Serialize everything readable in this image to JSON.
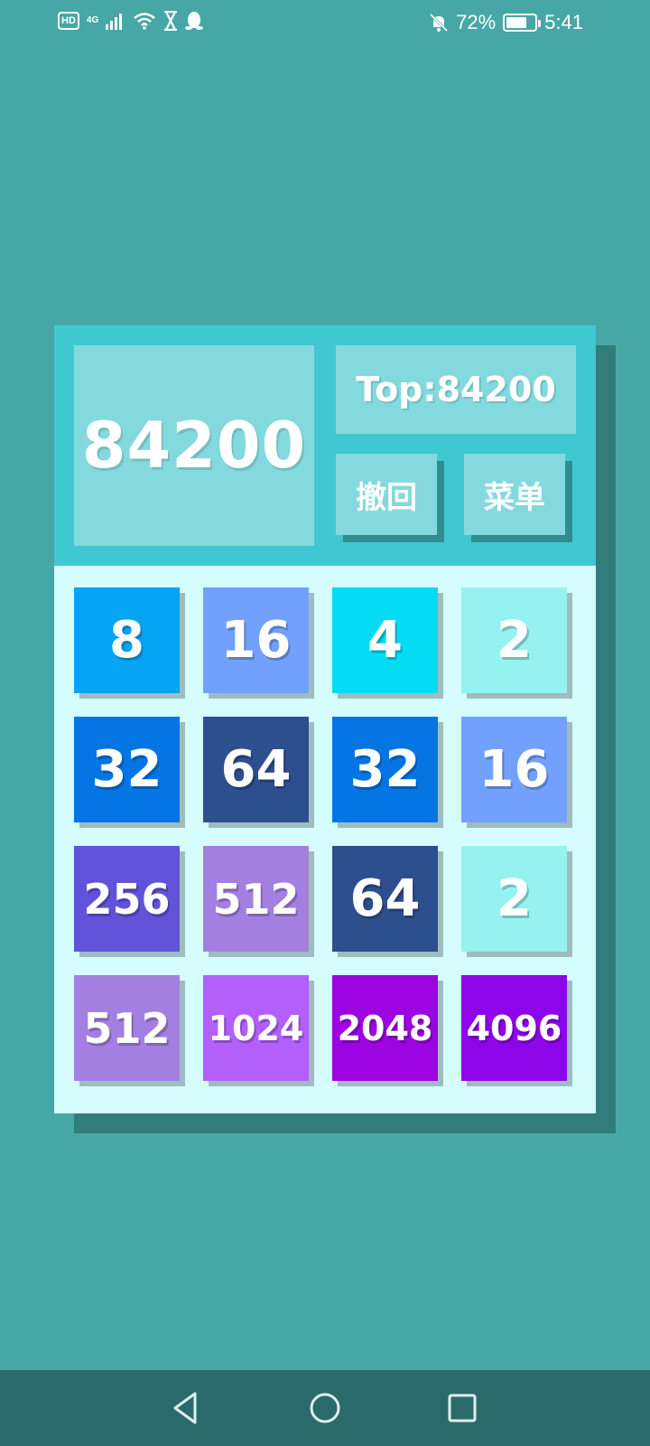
{
  "status_bar": {
    "hd": "HD",
    "network": "4G",
    "battery_percent": "72%",
    "battery_level": 0.72,
    "time": "5:41",
    "icons": [
      "signal-icon",
      "wifi-icon",
      "hourglass-icon",
      "qq-penguin-icon",
      "bell-off-icon",
      "battery-charging-icon"
    ]
  },
  "header": {
    "score": "84200",
    "top_score": "Top:84200",
    "undo_label": "撤回",
    "menu_label": "菜单"
  },
  "board": {
    "rows": [
      [
        8,
        16,
        4,
        2
      ],
      [
        32,
        64,
        32,
        16
      ],
      [
        256,
        512,
        64,
        2
      ],
      [
        512,
        1024,
        2048,
        4096
      ]
    ]
  },
  "tile_colors": {
    "2": "#95f2f0",
    "4": "#03dcf4",
    "8": "#05a5f4",
    "16": "#72a1fd",
    "32": "#0575e3",
    "64": "#2d4f8e",
    "256": "#6153d9",
    "512": "#a47fe2",
    "1024": "#b25ffc",
    "2048": "#9d04e2",
    "4096": "#8e05e9"
  },
  "nav": {
    "icons": [
      "back-icon",
      "home-icon",
      "recents-icon"
    ]
  }
}
